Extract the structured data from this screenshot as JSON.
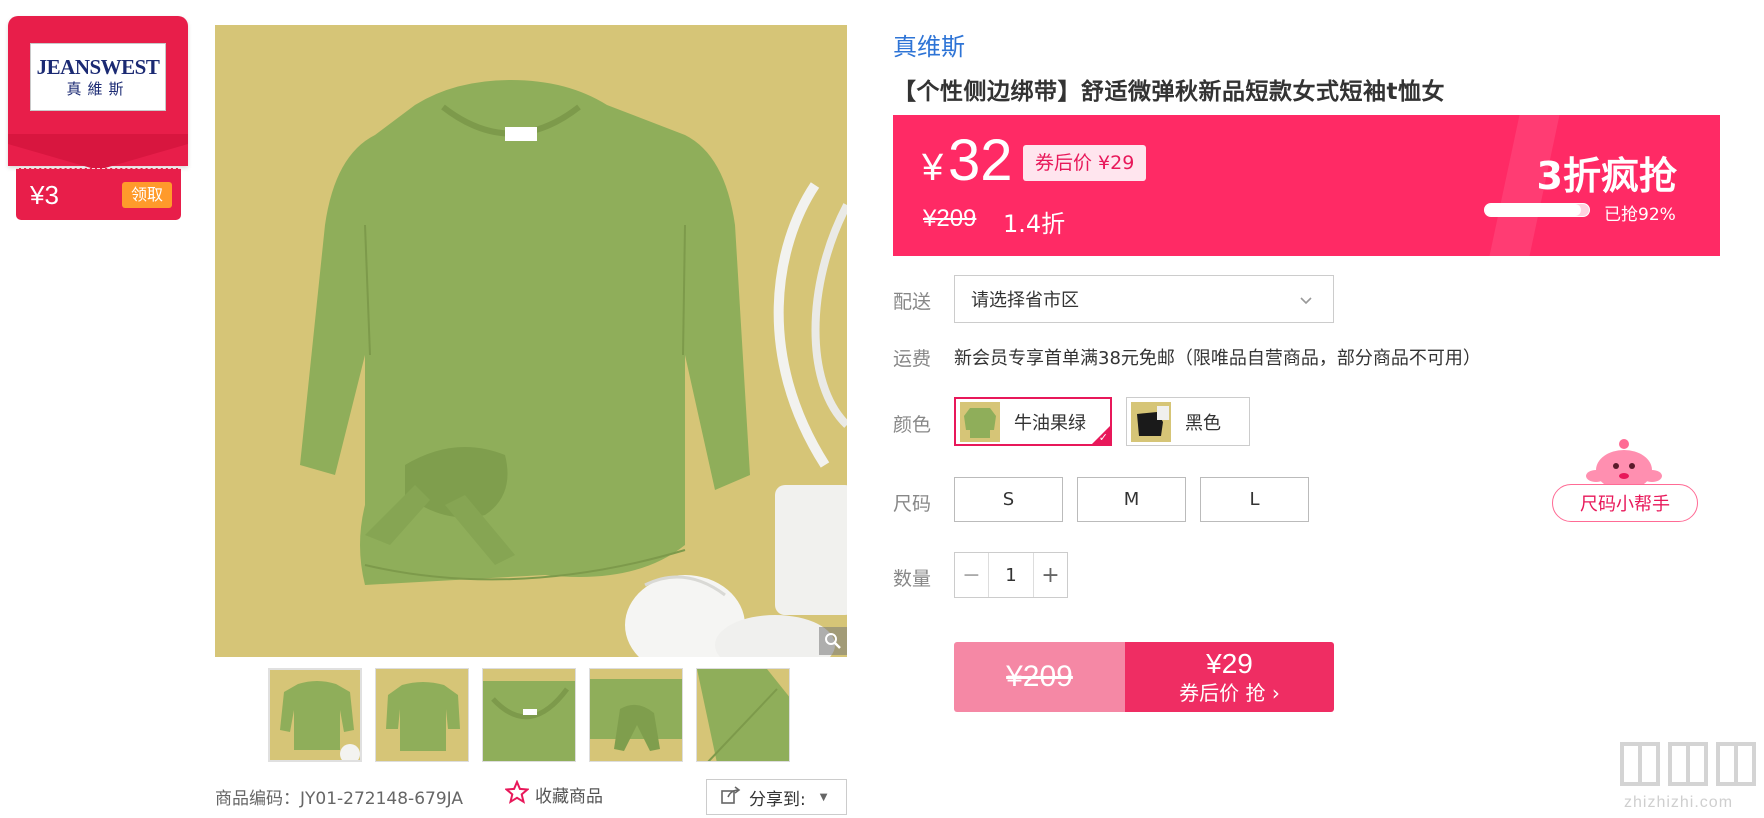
{
  "brand_card": {
    "logo_en": "JEANSWEST",
    "logo_cn": "真維斯",
    "coupon_amount": "¥3",
    "claim_label": "领取"
  },
  "gallery": {
    "thumb_count": 5
  },
  "footer": {
    "sku_label": "商品编码：JY01-272148-679JA",
    "favorite_label": "收藏商品",
    "share_label": "分享到:"
  },
  "product": {
    "brand": "真维斯",
    "title": "【个性侧边绑带】舒适微弹秋新品短款女式短袖t恤女"
  },
  "price": {
    "currency": "¥",
    "current": "32",
    "after_coupon": "券后价 ¥29",
    "original": "¥209",
    "discount": "1.4折",
    "promo_label": "3折疯抢",
    "sold_percent": 92,
    "sold_text": "已抢92%"
  },
  "delivery": {
    "label": "配送",
    "placeholder": "请选择省市区"
  },
  "shipping": {
    "label": "运费",
    "text": "新会员专享首单满38元免邮（限唯品自营商品，部分商品不可用）"
  },
  "colors": {
    "label": "颜色",
    "options": [
      {
        "name": "牛油果绿",
        "selected": true
      },
      {
        "name": "黑色",
        "selected": false
      }
    ]
  },
  "sizes": {
    "label": "尺码",
    "options": [
      "S",
      "M",
      "L"
    ],
    "helper_label": "尺码小帮手"
  },
  "quantity": {
    "label": "数量",
    "value": "1",
    "minus": "−",
    "plus": "+"
  },
  "buy_button": {
    "original_price": "¥209",
    "coupon_price": "¥29",
    "action_label": "券后价 抢 ›"
  },
  "watermark": {
    "text": "zhizhizhi.com"
  },
  "colors_theme": {
    "accent": "#ff2a65",
    "brand_blue": "#2e74d6",
    "shirt_green": "#8fae5a",
    "background_yellow": "#d6c577"
  }
}
